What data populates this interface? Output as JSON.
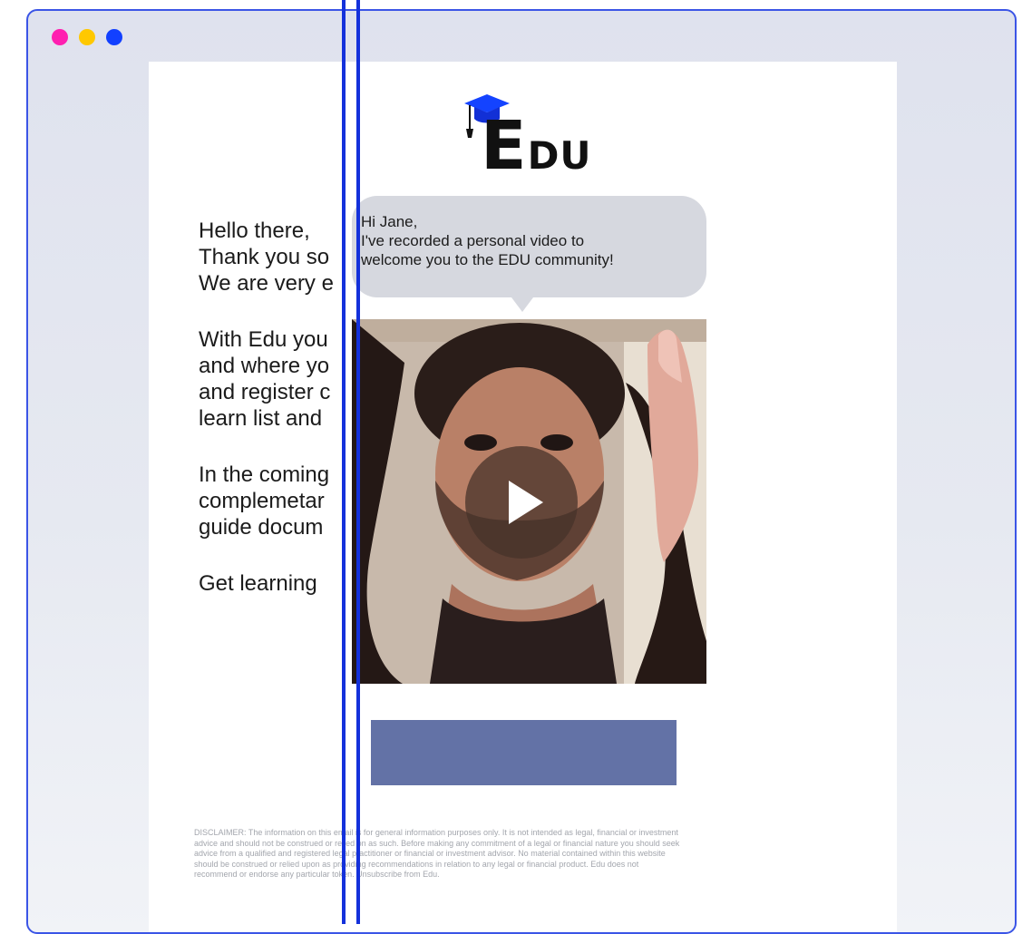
{
  "window": {
    "dots": [
      {
        "name": "pink-dot",
        "color": "#ff1fb0"
      },
      {
        "name": "yellow-dot",
        "color": "#ffc800"
      },
      {
        "name": "blue-dot",
        "color": "#1240ff"
      }
    ],
    "border_color": "#3b55e6"
  },
  "logo": {
    "text_e": "E",
    "text_rest": "DU",
    "icon": "graduation-cap-icon"
  },
  "email_text": {
    "paragraphs": [
      [
        "Hello there,",
        "Thank you so",
        "We are very e"
      ],
      [
        "With Edu you",
        "and where yo",
        "and register c",
        "learn list and"
      ],
      [
        "In the coming",
        "complemetar",
        "guide docum"
      ],
      [
        "Get learning"
      ]
    ]
  },
  "bubble": {
    "lines": [
      "Hi Jane,",
      "I've recorded a personal video to",
      "welcome you to the EDU community!"
    ]
  },
  "video": {
    "play_icon": "play-icon"
  },
  "cta": {
    "color": "#6372a6"
  },
  "disclaimer": {
    "lines": [
      "DISCLAIMER: The information on this email is for general information purposes only. It is not intended as legal, financial or investment",
      "advice and should not be construed or relied on as such. Before making any commitment of a legal or financial nature you should seek",
      "advice from a qualified and registered legal practitioner or financial or investment advisor. No material contained within this website",
      "should be construed or relied upon as providing recommendations in relation to any legal or financial product. Edu does not",
      "recommend or endorse any particular token. Unsubscribe from Edu."
    ]
  },
  "colors": {
    "split_line": "#1431db"
  }
}
